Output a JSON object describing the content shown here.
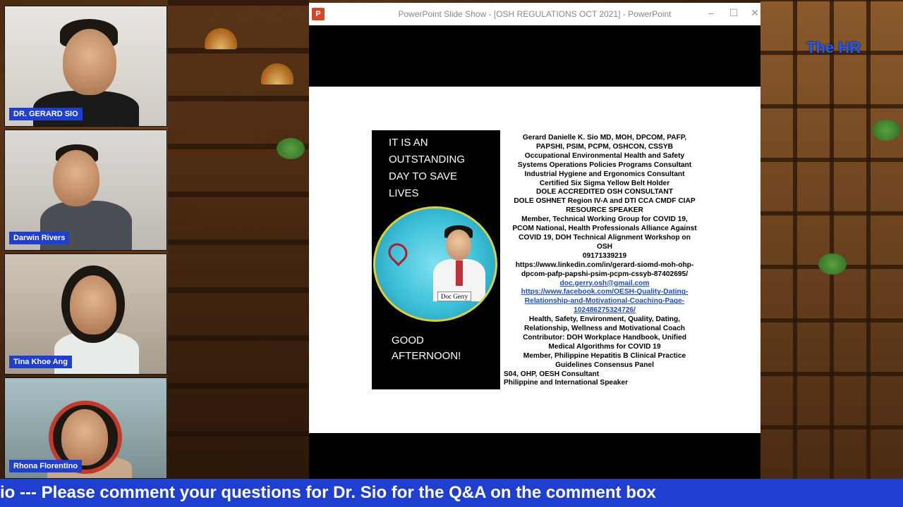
{
  "window": {
    "title": "PowerPoint Slide Show - [OSH REGULATIONS OCT 2021] - PowerPoint",
    "app_icon": "powerpoint-icon",
    "controls": [
      "minimize-icon",
      "maximize-icon",
      "close-icon"
    ]
  },
  "participants": [
    {
      "name": "DR. GERARD SIO"
    },
    {
      "name": "Darwin Rivers"
    },
    {
      "name": "Tina Khoe Ang"
    },
    {
      "name": "Rhona Florentino"
    }
  ],
  "slide": {
    "poster_top": [
      "IT IS AN",
      "OUTSTANDING",
      "DAY TO SAVE",
      "LIVES"
    ],
    "poster_bottom": [
      "GOOD",
      "AFTERNOON!"
    ],
    "badge_label": "Doc Gerry",
    "bio_lines": [
      "Gerard Danielle K. Sio MD, MOH, DPCOM, PAFP,",
      "PAPSHI, PSIM, PCPM, OSHCON, CSSYB",
      "Occupational Environmental Health and  Safety",
      "Systems Operations Policies Programs Consultant",
      "Industrial Hygiene and Ergonomics Consultant",
      "Certified Six Sigma Yellow Belt Holder",
      "DOLE ACCREDITED OSH CONSULTANT",
      "DOLE OSHNET Region IV-A and DTI CCA CMDF CIAP",
      "RESOURCE SPEAKER",
      "Member, Technical Working Group for COVID 19,",
      "PCOM National, Health Professionals Alliance Against",
      "COVID 19, DOH Technical Alignment Workshop on",
      "OSH",
      "09171339219",
      "https://www.linkedin.com/in/gerard-siomd-moh-ohp-",
      "dpcom-pafp-papshi-psim-pcpm-cssyb-87402695/"
    ],
    "email": "doc.gerry.osh@gmail.com",
    "facebook_lines": [
      "https://www.facebook.com/OESH-Quality-Dating-",
      "Relationship-and-Motivational-Coaching-Page-",
      "102486275324726/"
    ],
    "bio_lines_2": [
      "Health, Safety, Environment, Quality, Dating,",
      "Relationship, Wellness and Motivational Coach",
      "Contributor: DOH Workplace Handbook, Unified",
      "Medical Algorithms for COVID 19",
      "Member, Philippine Hepatitis B Clinical Practice",
      "Guidelines Consensus Panel"
    ],
    "bio_left_lines": [
      "S04, OHP, OESH Consultant",
      "Philippine and International Speaker"
    ]
  },
  "brand": {
    "logo_text": "The HR"
  },
  "ticker": {
    "text": "io --- Please comment your questions for Dr. Sio for the Q&A on the comment box"
  },
  "colors": {
    "name_tag": "#1f3fd1",
    "ticker": "#1f3fd1",
    "link": "#1f4fb6"
  }
}
